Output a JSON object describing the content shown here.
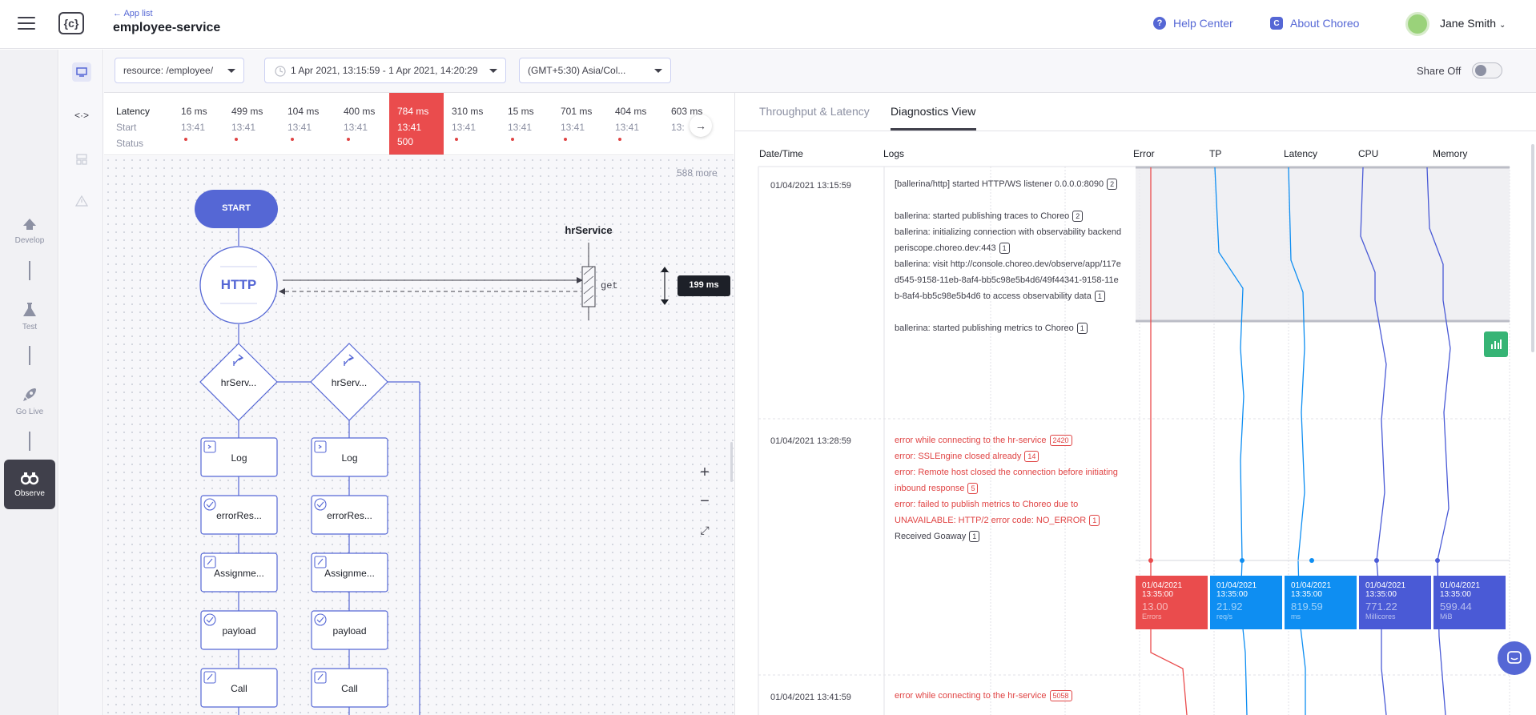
{
  "header": {
    "back_label": "← App list",
    "app_title": "employee-service",
    "help_center": "Help Center",
    "about": "About Choreo",
    "user_name": "Jane Smith"
  },
  "rail": {
    "items": [
      {
        "label": "Develop",
        "icon": "flask-icon"
      },
      {
        "label": "Test",
        "icon": "beaker-icon"
      },
      {
        "label": "Go Live",
        "icon": "rocket-icon"
      },
      {
        "label": "Observe",
        "icon": "binoculars-icon"
      }
    ]
  },
  "filters": {
    "resource": "resource: /employee/",
    "time_range": "1 Apr 2021, 13:15:59 - 1 Apr 2021, 14:20:29",
    "timezone": "(GMT+5:30) Asia/Col...",
    "share_label": "Share Off"
  },
  "metrics": {
    "row_labels": {
      "latency": "Latency",
      "start": "Start",
      "status": "Status"
    },
    "columns": [
      {
        "latency": "16 ms",
        "start": "13:41",
        "status": ""
      },
      {
        "latency": "499 ms",
        "start": "13:41",
        "status": ""
      },
      {
        "latency": "104 ms",
        "start": "13:41",
        "status": ""
      },
      {
        "latency": "400 ms",
        "start": "13:41",
        "status": ""
      },
      {
        "latency": "784 ms",
        "start": "13:41",
        "status": "500"
      },
      {
        "latency": "310 ms",
        "start": "13:41",
        "status": ""
      },
      {
        "latency": "15 ms",
        "start": "13:41",
        "status": ""
      },
      {
        "latency": "701 ms",
        "start": "13:41",
        "status": ""
      },
      {
        "latency": "404 ms",
        "start": "13:41",
        "status": ""
      },
      {
        "latency": "603 ms",
        "start": "13:",
        "status": ""
      }
    ]
  },
  "diagram": {
    "more": "588 more",
    "start": "START",
    "http": "HTTP",
    "service_name": "hrService",
    "method": "get",
    "latency_badge": "199 ms",
    "branch_labels": [
      "hrServ...",
      "hrServ..."
    ],
    "step_labels": [
      "Log",
      "errorRes...",
      "Assignme...",
      "payload",
      "Call"
    ]
  },
  "tabs": [
    "Throughput & Latency",
    "Diagnostics View"
  ],
  "active_tab": "Diagnostics View",
  "table": {
    "headers": {
      "datetime": "Date/Time",
      "logs": "Logs",
      "error": "Error",
      "tp": "TP",
      "latency": "Latency",
      "cpu": "CPU",
      "memory": "Memory"
    },
    "rows": [
      {
        "date": "01/04/2021 13:15:59",
        "lines": [
          {
            "text": "[ballerina/http] started HTTP/WS listener 0.0.0.0:8090",
            "count": "2",
            "err": false
          },
          {
            "text": "ballerina: started publishing traces to Choreo",
            "count": "2",
            "err": false
          },
          {
            "text": "ballerina: initializing connection with observability backend periscope.choreo.dev:443",
            "count": "1",
            "err": false
          },
          {
            "text": "ballerina: visit http://console.choreo.dev/observe/app/117ed545-9158-11eb-8af4-bb5c98e5b4d6/49f44341-9158-11eb-8af4-bb5c98e5b4d6 to access observability data",
            "count": "1",
            "err": false
          },
          {
            "text": "ballerina: started publishing metrics to Choreo",
            "count": "1",
            "err": false
          }
        ]
      },
      {
        "date": "01/04/2021 13:28:59",
        "lines": [
          {
            "text": "error while connecting to the hr-service",
            "count": "2420",
            "err": true
          },
          {
            "text": "error: SSLEngine closed already",
            "count": "14",
            "err": true
          },
          {
            "text": "error: Remote host closed the connection before initiating inbound response",
            "count": "5",
            "err": true
          },
          {
            "text": "error: failed to publish metrics to Choreo due to UNAVAILABLE: HTTP/2 error code: NO_ERROR",
            "count": "1",
            "err": true
          },
          {
            "text": "Received Goaway",
            "count": "1",
            "err": false
          }
        ]
      },
      {
        "date": "01/04/2021 13:41:59",
        "lines": [
          {
            "text": "error while connecting to the hr-service",
            "count": "5058",
            "err": true
          }
        ]
      }
    ]
  },
  "tooltips": [
    {
      "time": "01/04/2021 13:35:00",
      "value": "13.00",
      "unit": "Errors",
      "color": "#ea4c4d"
    },
    {
      "time": "01/04/2021 13:35:00",
      "value": "21.92",
      "unit": "req/s",
      "color": "#0e8ef2"
    },
    {
      "time": "01/04/2021 13:35:00",
      "value": "819.59",
      "unit": "ms",
      "color": "#0e8ef2"
    },
    {
      "time": "01/04/2021 13:35:00",
      "value": "771.22",
      "unit": "Millicores",
      "color": "#4a5ad6"
    },
    {
      "time": "01/04/2021 13:35:00",
      "value": "599.44",
      "unit": "MiB",
      "color": "#4a5ad6"
    }
  ],
  "colors": {
    "accent": "#5567d5",
    "error": "#ea4c4d",
    "tp": "#0e8ef2",
    "cpu": "#4a5ad6",
    "green": "#36b475"
  }
}
